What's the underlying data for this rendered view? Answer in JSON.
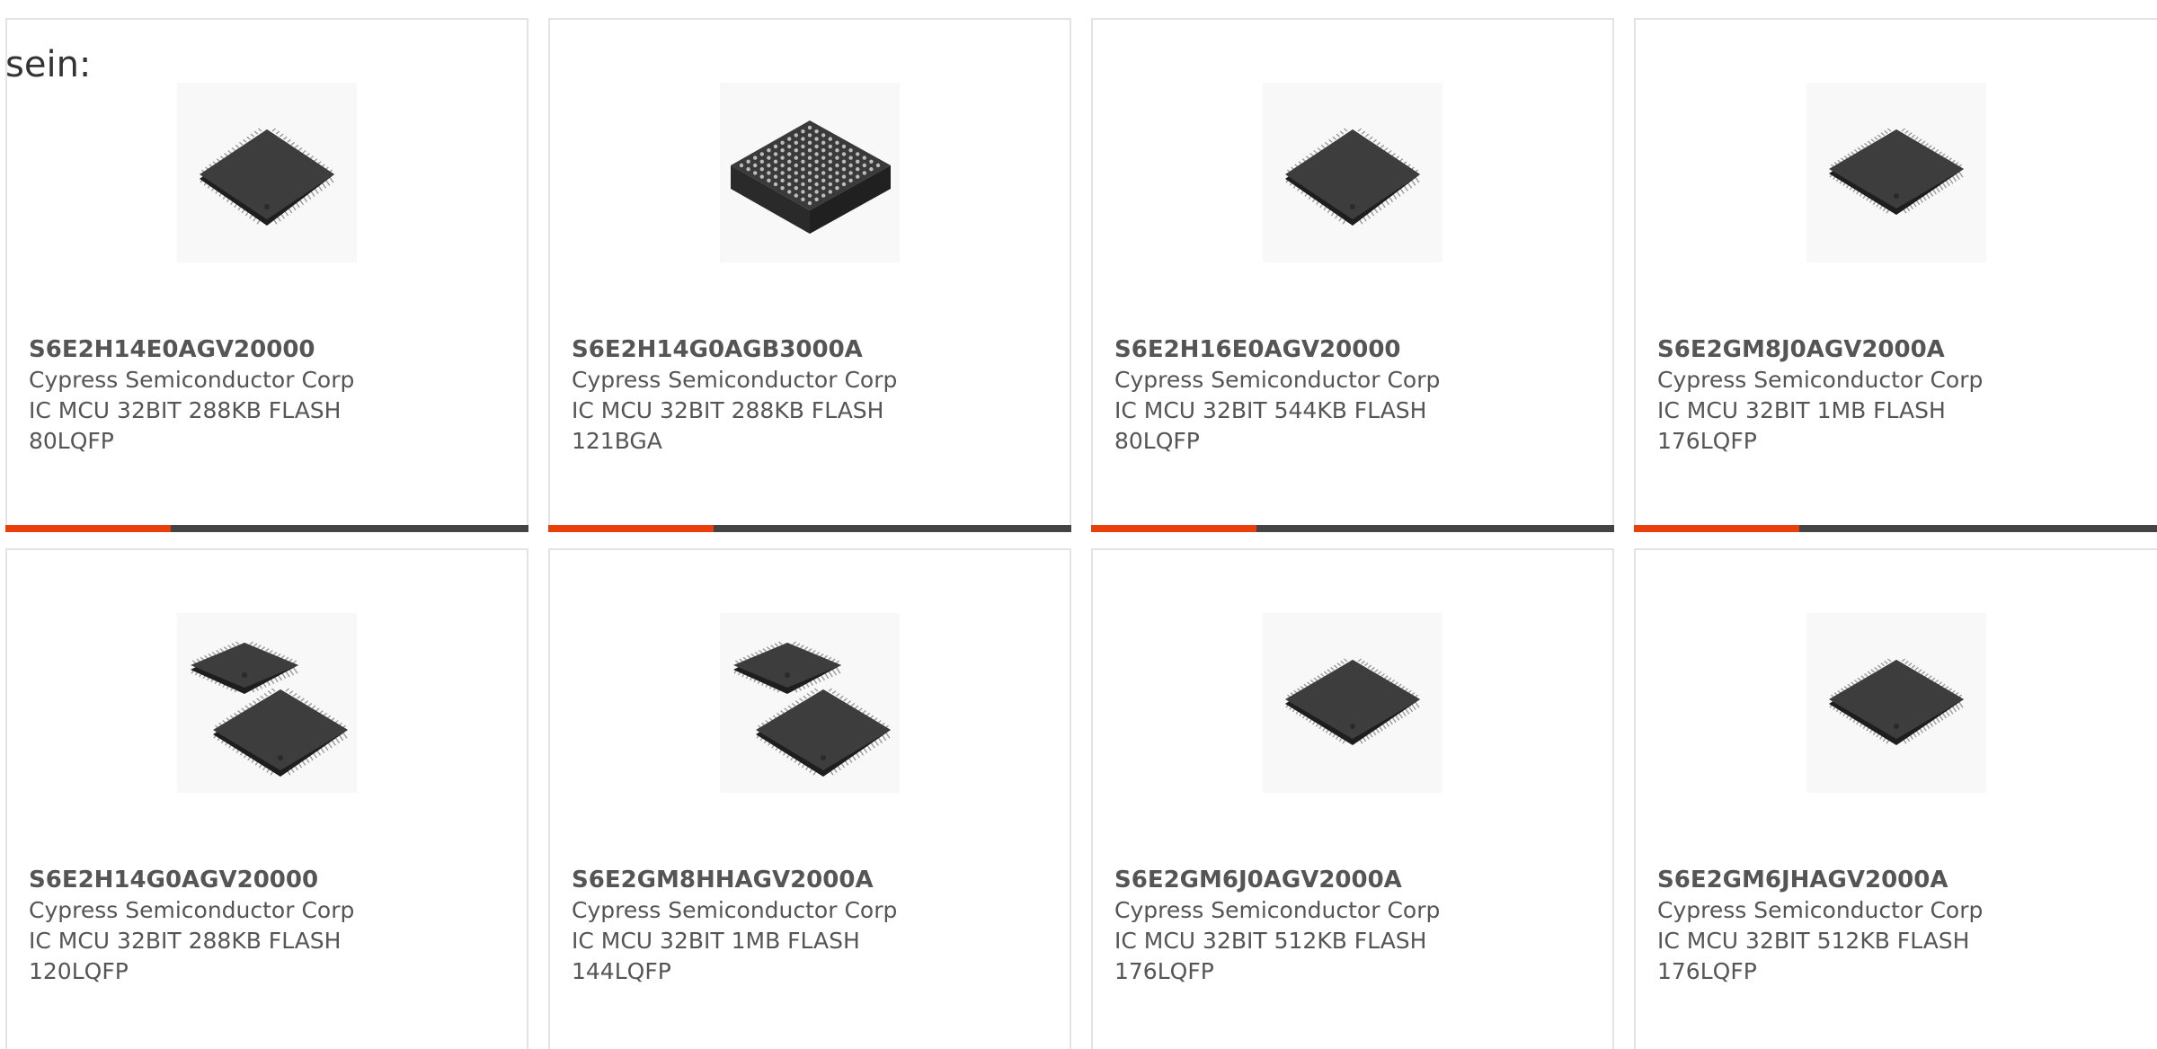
{
  "intro_text": "sein:",
  "colors": {
    "accent": "#e8400c",
    "bar": "#444444",
    "border": "#e3e3e3"
  },
  "products": [
    {
      "part": "S6E2H14E0AGV20000",
      "maker": "Cypress Semiconductor Corp",
      "desc": "IC MCU 32BIT 288KB FLASH 80LQFP",
      "image": "qfp-chip-icon"
    },
    {
      "part": "S6E2H14G0AGB3000A",
      "maker": "Cypress Semiconductor Corp",
      "desc": "IC MCU 32BIT 288KB FLASH 121BGA",
      "image": "bga-chip-icon"
    },
    {
      "part": "S6E2H16E0AGV20000",
      "maker": "Cypress Semiconductor Corp",
      "desc": "IC MCU 32BIT 544KB FLASH 80LQFP",
      "image": "qfp-chip-icon"
    },
    {
      "part": "S6E2GM8J0AGV2000A",
      "maker": "Cypress Semiconductor Corp",
      "desc": "IC MCU 32BIT 1MB FLASH 176LQFP",
      "image": "lqfp-flat-chip-icon"
    },
    {
      "part": "S6E2H14G0AGV20000",
      "maker": "Cypress Semiconductor Corp",
      "desc": "IC MCU 32BIT 288KB FLASH 120LQFP",
      "image": "two-chips-icon"
    },
    {
      "part": "S6E2GM8HHAGV2000A",
      "maker": "Cypress Semiconductor Corp",
      "desc": "IC MCU 32BIT 1MB FLASH 144LQFP",
      "image": "two-chips-icon"
    },
    {
      "part": "S6E2GM6J0AGV2000A",
      "maker": "Cypress Semiconductor Corp",
      "desc": "IC MCU 32BIT 512KB FLASH 176LQFP",
      "image": "lqfp-flat-chip-icon"
    },
    {
      "part": "S6E2GM6JHAGV2000A",
      "maker": "Cypress Semiconductor Corp",
      "desc": "IC MCU 32BIT 512KB FLASH 176LQFP",
      "image": "lqfp-flat-chip-icon"
    }
  ]
}
